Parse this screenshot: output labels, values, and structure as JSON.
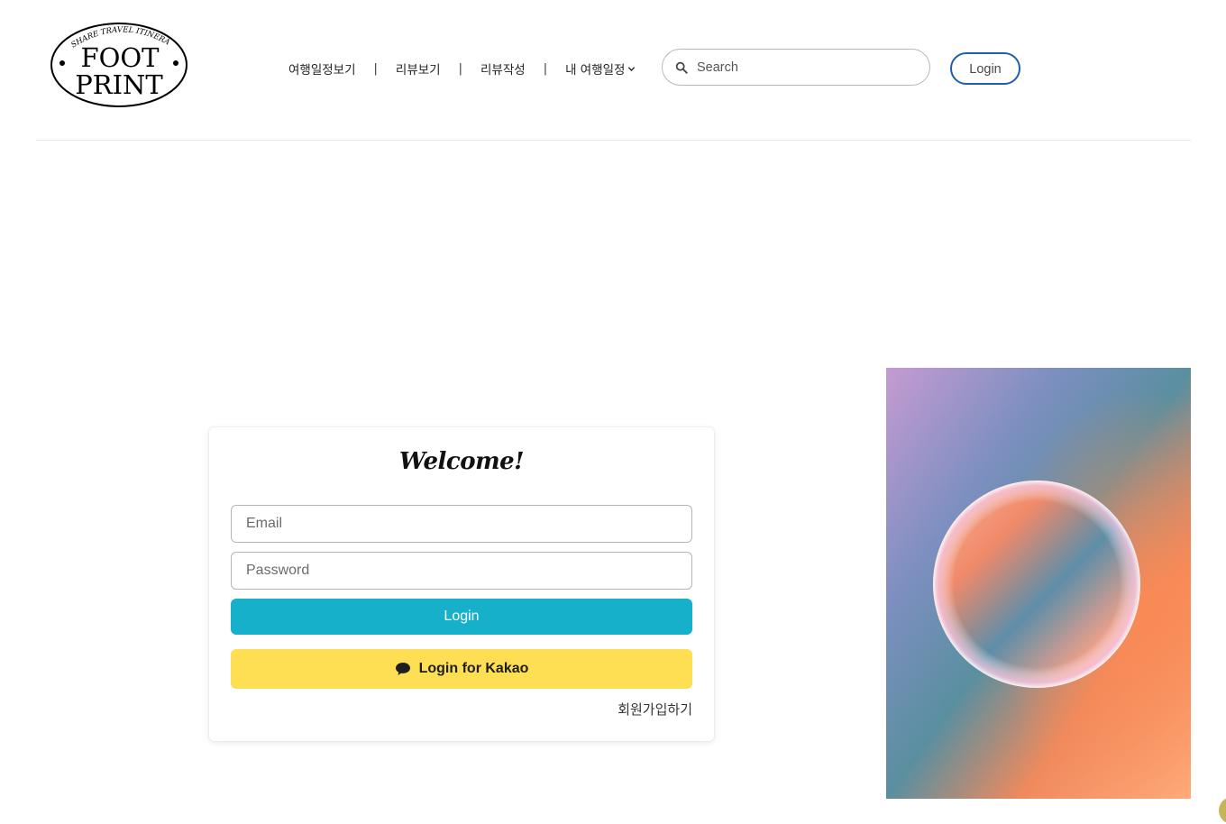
{
  "header": {
    "logo": {
      "top_text": "SHARE TRAVEL ITINERARY",
      "line1": "FOOT",
      "line2": "PRINT"
    },
    "nav": {
      "items": [
        {
          "label": "여행일정보기"
        },
        {
          "label": "리뷰보기"
        },
        {
          "label": "리뷰작성"
        },
        {
          "label": "내 여행일정"
        }
      ],
      "separator": "|"
    },
    "search": {
      "placeholder": "Search",
      "value": ""
    },
    "login_label": "Login"
  },
  "login_card": {
    "title": "Welcome!",
    "email_placeholder": "Email",
    "password_placeholder": "Password",
    "login_label": "Login",
    "kakao_label": "Login for Kakao",
    "signup_label": "회원가입하기"
  },
  "colors": {
    "accent_login": "#17b0cb",
    "kakao": "#fede52",
    "header_login_border": "#1f5fb1"
  },
  "icons": [
    "search-icon",
    "chevron-down-icon",
    "chat-bubble-icon"
  ]
}
